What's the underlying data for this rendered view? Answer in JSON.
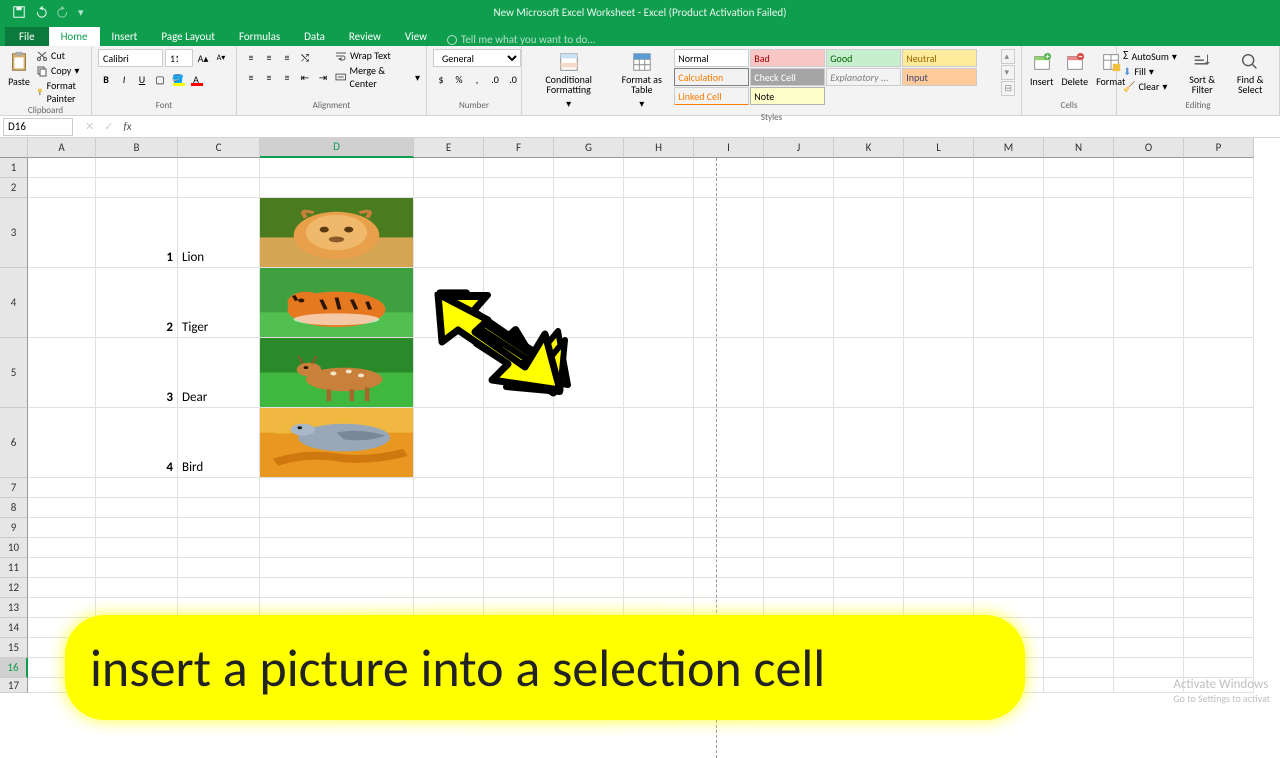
{
  "title": "New Microsoft Excel Worksheet - Excel (Product Activation Failed)",
  "tabs": {
    "file": "File",
    "home": "Home",
    "insert": "Insert",
    "pagelayout": "Page Layout",
    "formulas": "Formulas",
    "data": "Data",
    "review": "Review",
    "view": "View"
  },
  "tellme": "Tell me what you want to do...",
  "clipboard": {
    "paste": "Paste",
    "cut": "Cut",
    "copy": "Copy",
    "painter": "Format Painter",
    "label": "Clipboard"
  },
  "font": {
    "name": "Calibri",
    "size": "11",
    "label": "Font"
  },
  "alignment": {
    "wrap": "Wrap Text",
    "merge": "Merge & Center",
    "label": "Alignment"
  },
  "number": {
    "format": "General",
    "label": "Number"
  },
  "styles": {
    "conditional": "Conditional Formatting",
    "table": "Format as Table",
    "s1": "Normal",
    "s2": "Bad",
    "s3": "Good",
    "s4": "Neutral",
    "s5": "Calculation",
    "s6": "Check Cell",
    "s7": "Explanatory ...",
    "s8": "Input",
    "s9": "Linked Cell",
    "s10": "Note",
    "label": "Styles"
  },
  "cells": {
    "insert": "Insert",
    "delete": "Delete",
    "format": "Format",
    "label": "Cells"
  },
  "editing": {
    "autosum": "AutoSum",
    "fill": "Fill",
    "clear": "Clear",
    "sort": "Sort & Filter",
    "find": "Find & Select",
    "label": "Editing"
  },
  "namebox": "D16",
  "columns": [
    "A",
    "B",
    "C",
    "D",
    "E",
    "F",
    "G",
    "H",
    "I",
    "J",
    "K",
    "L",
    "M",
    "N",
    "O",
    "P"
  ],
  "data_rows": [
    {
      "num": "1",
      "name": "Lion"
    },
    {
      "num": "2",
      "name": "Tiger"
    },
    {
      "num": "3",
      "name": "Dear"
    },
    {
      "num": "4",
      "name": "Bird"
    }
  ],
  "annotation": "insert a picture into a selection cell",
  "watermark": {
    "title": "Activate Windows",
    "sub": "Go to Settings to activat"
  }
}
